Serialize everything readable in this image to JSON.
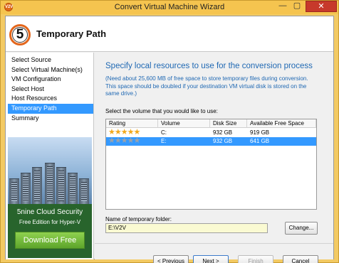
{
  "window": {
    "title": "Convert Virtual Machine Wizard",
    "app_icon_text": "V2V",
    "minimize_glyph": "—",
    "maximize_glyph": "▢",
    "close_glyph": "✕"
  },
  "header": {
    "step_number": "5",
    "title": "Temporary Path"
  },
  "sidebar": {
    "items": [
      {
        "label": "Select Source",
        "active": false
      },
      {
        "label": "Select Virtual Machine(s)",
        "active": false
      },
      {
        "label": "VM Configuration",
        "active": false
      },
      {
        "label": "Select Host",
        "active": false
      },
      {
        "label": "Host Resources",
        "active": false
      },
      {
        "label": "Temporary Path",
        "active": true
      },
      {
        "label": "Summary",
        "active": false
      }
    ],
    "promo": {
      "line1": "5nine Cloud Security",
      "line2": "Free Edition for Hyper-V",
      "button_label": "Download Free"
    }
  },
  "main": {
    "heading": "Specify local resources to use for the conversion process",
    "note": "(Need about 25,600 MB of free space to store temporary files during conversion. This space should be doubled if your destination VM virtual disk is stored on the same drive.)",
    "select_label": "Select the volume that you would like to use:",
    "table": {
      "columns": [
        "Rating",
        "Volume",
        "Disk Size",
        "Available Free Space"
      ],
      "rows": [
        {
          "rating": 5,
          "volume": "C:",
          "disk_size": "932 GB",
          "free_space": "919 GB",
          "selected": false
        },
        {
          "rating": 5,
          "volume": "E:",
          "disk_size": "932 GB",
          "free_space": "641 GB",
          "selected": true
        }
      ]
    },
    "folder_label": "Name of temporary folder:",
    "folder_value": "E:\\V2V",
    "change_button": "Change..."
  },
  "footer": {
    "back_label": "< Previous",
    "next_label": "Next >",
    "finish_label": "Finish",
    "cancel_label": "Cancel"
  },
  "colors": {
    "title_bar": "#f5c44f",
    "selection": "#3399ff",
    "heading_text": "#1f68b3",
    "star_gold": "#f2a91c",
    "star_gray": "#9aa3ad",
    "promo_green": "#28642c"
  }
}
